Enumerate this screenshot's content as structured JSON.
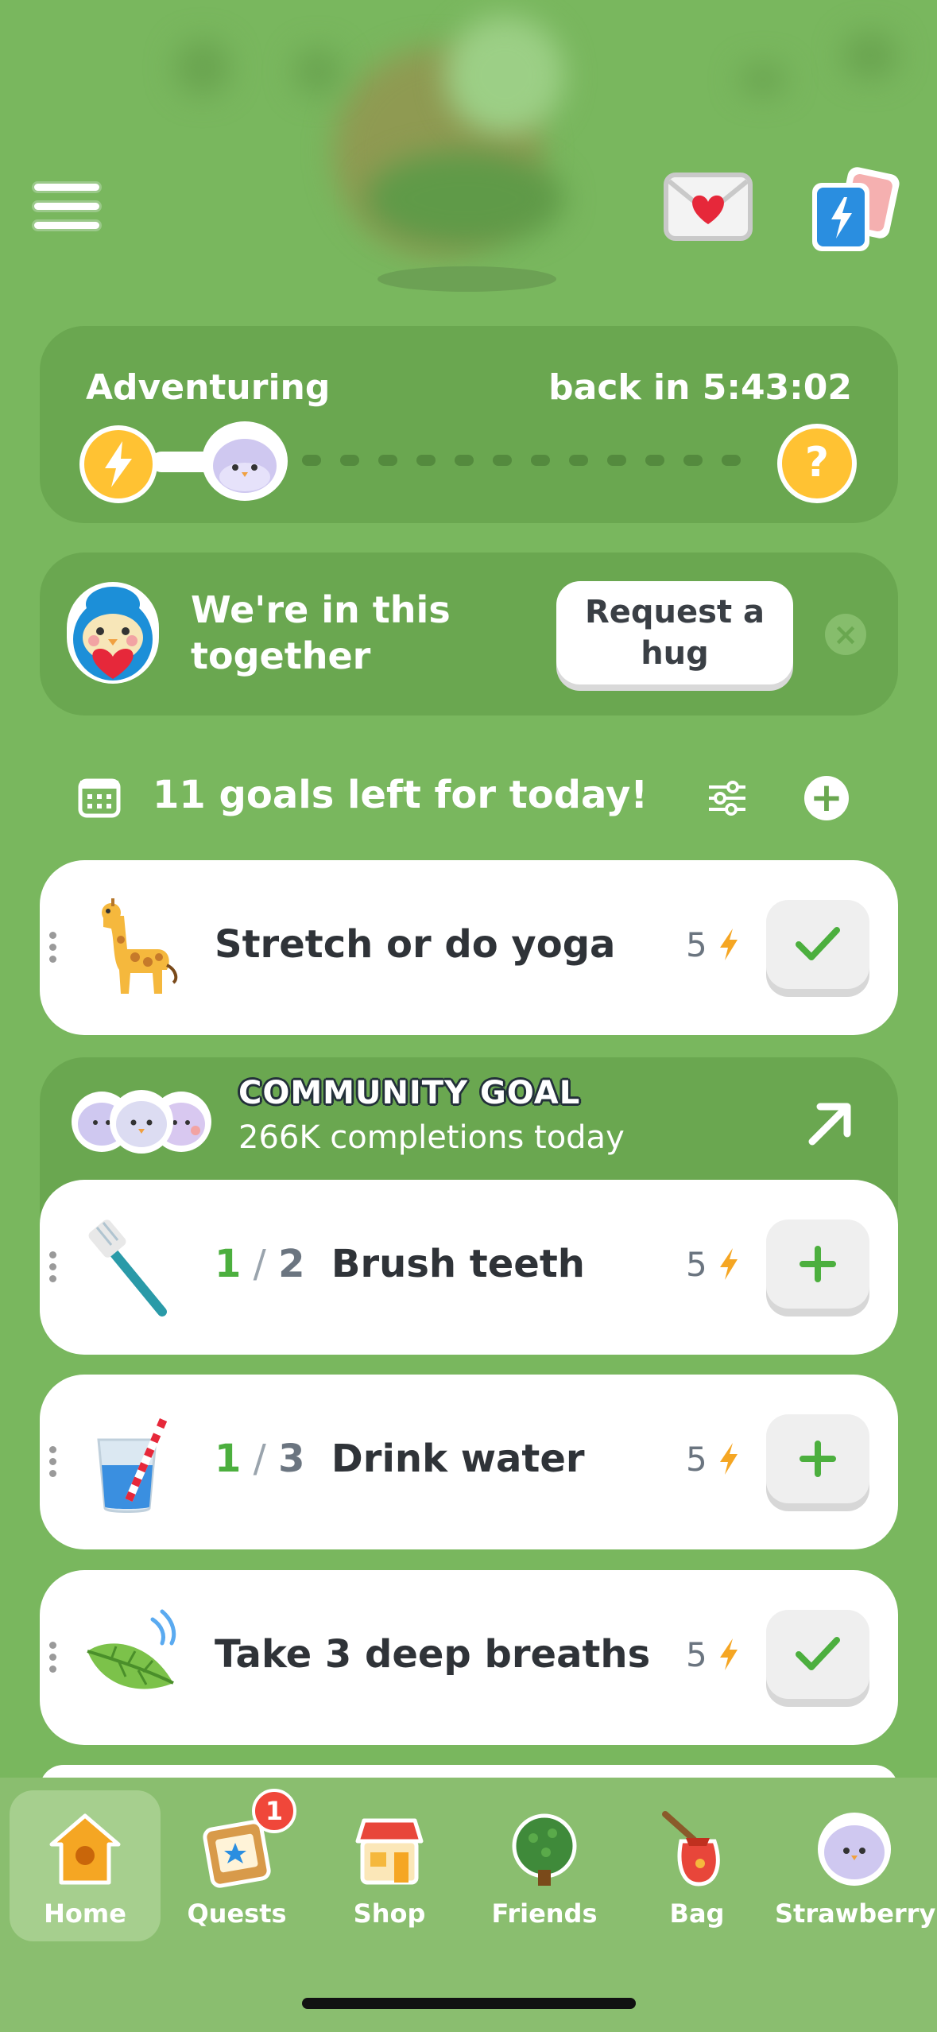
{
  "adventure": {
    "status": "Adventuring",
    "timer": "back in 5:43:02"
  },
  "hug": {
    "message": "We're in this together",
    "button": "Request a hug"
  },
  "goals": {
    "header": "11 goals left for today!",
    "tasks": [
      {
        "name": "Stretch or do yoga",
        "points": "5",
        "icon": "giraffe-icon",
        "action": "check"
      },
      {
        "name": "Brush teeth",
        "done": "1",
        "total": "2",
        "points": "5",
        "icon": "toothbrush-icon",
        "action": "plus"
      },
      {
        "name": "Drink water",
        "done": "1",
        "total": "3",
        "points": "5",
        "icon": "water-glass-icon",
        "action": "plus"
      },
      {
        "name": "Take 3 deep breaths",
        "points": "5",
        "icon": "leaf-icon",
        "action": "check"
      }
    ]
  },
  "community": {
    "title": "COMMUNITY GOAL",
    "subtitle": "266K completions today"
  },
  "nav": {
    "items": [
      {
        "label": "Home",
        "icon": "birdhouse-icon",
        "active": true
      },
      {
        "label": "Quests",
        "icon": "quests-icon"
      },
      {
        "label": "Shop",
        "icon": "shop-icon"
      },
      {
        "label": "Friends",
        "icon": "tree-icon"
      },
      {
        "label": "Bag",
        "icon": "bag-icon"
      },
      {
        "label": "Strawberry",
        "icon": "pet-avatar-icon"
      }
    ],
    "quests_badge": "1"
  },
  "colors": {
    "background": "#79b75e",
    "card_dark": "#6aa750",
    "accent_green": "#4caf3e",
    "energy_yellow": "#ffc233",
    "bolt_orange": "#f5a623"
  }
}
